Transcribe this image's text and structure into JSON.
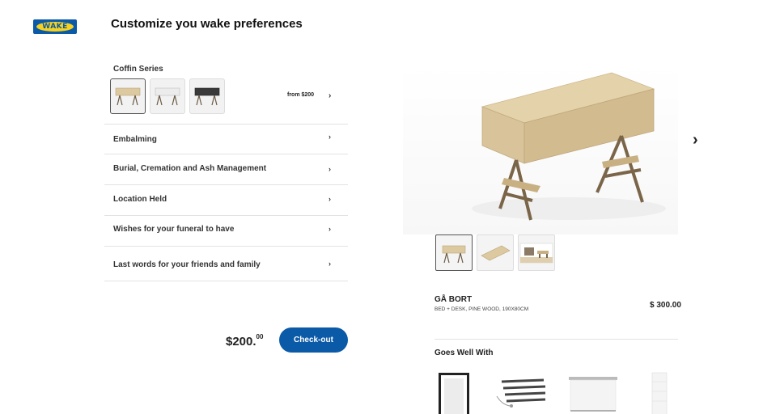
{
  "brand": {
    "logo_text": "WAKE",
    "colors": {
      "blue": "#0a5aa8",
      "yellow": "#f6d11e"
    }
  },
  "header": {
    "title": "Customize you wake preferences"
  },
  "series": {
    "label": "Coffin Series",
    "from_price": "from $200",
    "swatches": [
      {
        "name": "pine-wood",
        "color": "#dcc9a0",
        "selected": true
      },
      {
        "name": "white",
        "color": "#e6e6e6",
        "selected": false
      },
      {
        "name": "black",
        "color": "#3a3a3a",
        "selected": false
      }
    ]
  },
  "options": [
    {
      "label": "Embalming"
    },
    {
      "label": "Burial, Cremation and Ash Management"
    },
    {
      "label": "Location Held"
    },
    {
      "label": "Wishes for your funeral to have"
    },
    {
      "label": "Last words for your friends and family"
    }
  ],
  "checkout": {
    "price_main": "$200.",
    "price_cents": "00",
    "button_label": "Check-out",
    "accent": "#0b5aa7"
  },
  "product": {
    "name": "GÅ BORT",
    "description": "BED + DESK, PINE WOOD, 190X80CM",
    "price": "$ 300.00",
    "thumbnails": [
      "desk-front",
      "desk-top",
      "room-scene"
    ]
  },
  "recommendations": {
    "title": "Goes Well With",
    "items": [
      "frame",
      "curtain-rods",
      "roller-blind",
      "shelf"
    ]
  },
  "icons": {
    "chevron": "chevron-right-icon",
    "next": "next-arrow-icon"
  }
}
